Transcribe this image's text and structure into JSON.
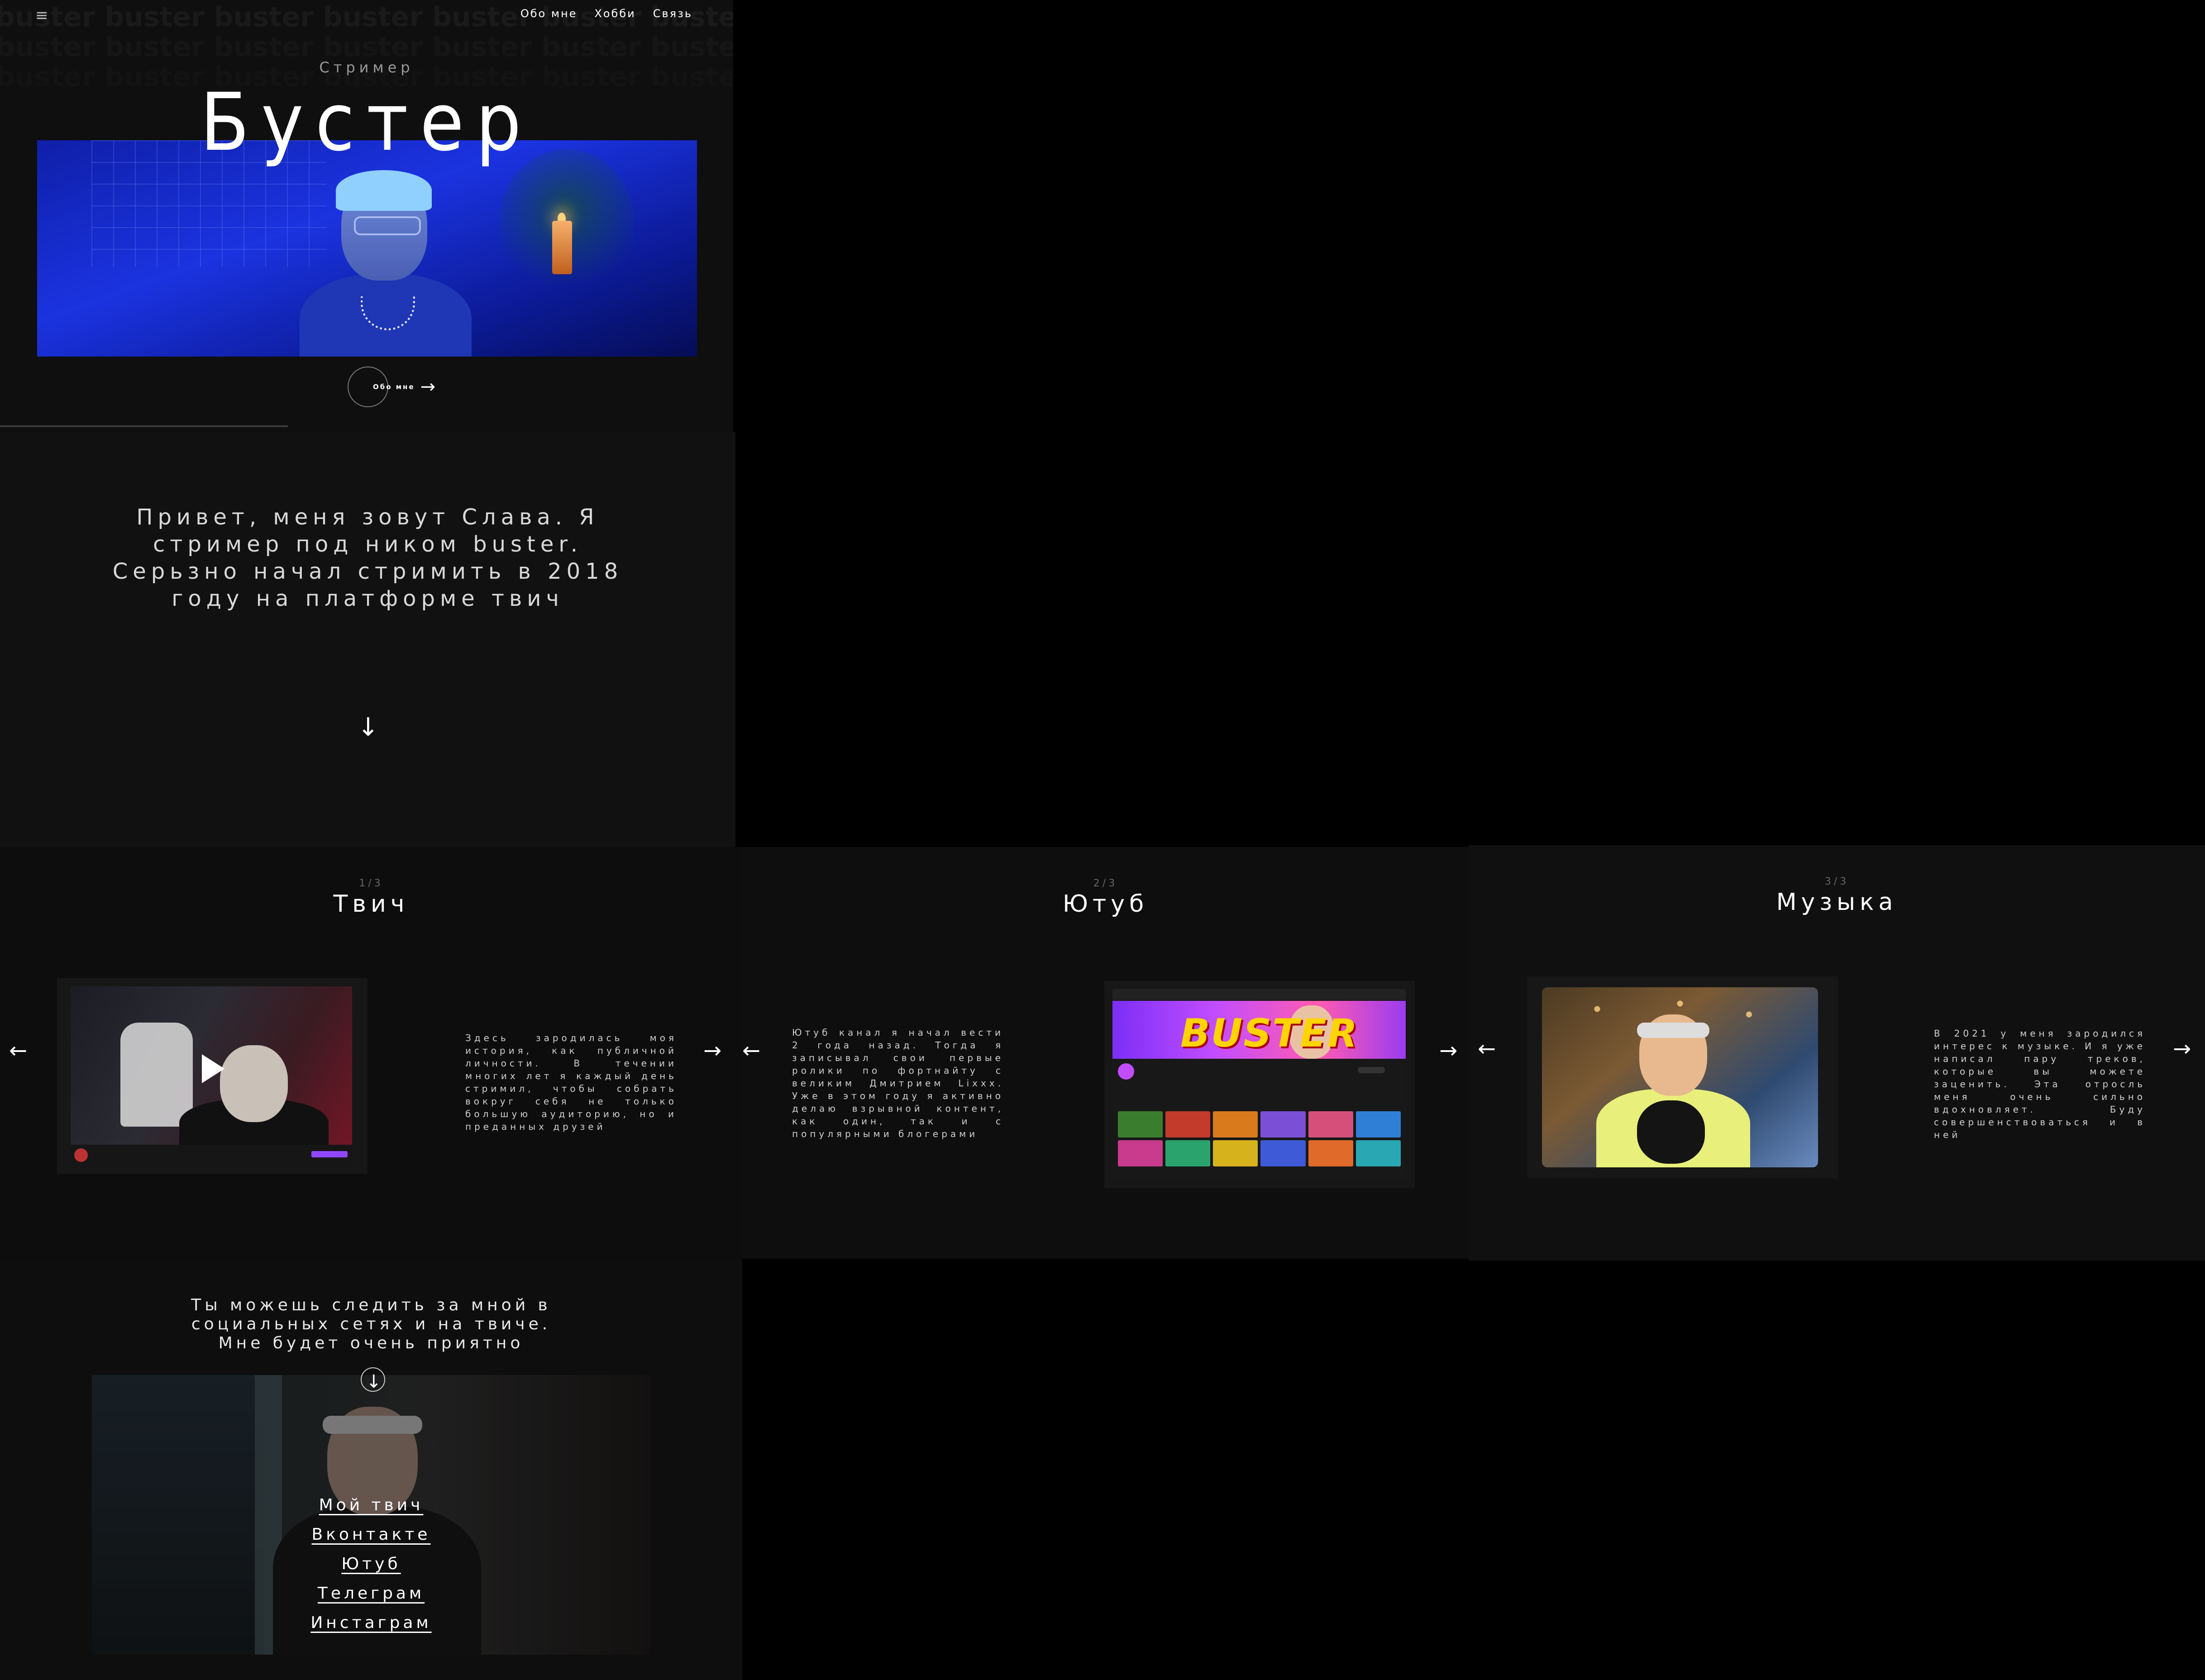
{
  "header": {
    "bg_word": "buster",
    "nav": [
      "Обо мне",
      "Хобби",
      "Связь"
    ]
  },
  "hero": {
    "subtitle": "Стример",
    "title": "Бустер",
    "about_button": "Обо мне",
    "arrow": "→"
  },
  "intro": {
    "text": "Привет, меня зовут Слава. Я стример под ником buster. Серьзно начал стримить в 2018 году на платформе твич",
    "arrow": "↓"
  },
  "slides": [
    {
      "counter": "1/3",
      "title": "Твич",
      "description": "Здесь зародилась моя история, как публичной личности. В течении многих лет я каждый день стримил, чтобы собрать вокруг себя не только большую аудиторию, но и преданных друзей"
    },
    {
      "counter": "2/3",
      "title": "Ютуб",
      "description": "Ютуб канал я начал вести 2 года назад. Тогда я записывал свои первые ролики по фортнайту с великим Дмитрием Lixxx. Уже в этом году я активно делаю взрывной контент, как один, так и с популярными блогерами",
      "banner_logo": "BUSTER"
    },
    {
      "counter": "3/3",
      "title": "Музыка",
      "description": "В 2021 у меня зародился интерес к музыке. И я уже написал пару треков, которые вы можете заценить. Эта отросль меня очень сильно вдохновляет. Буду совершенствоваться и в ней"
    }
  ],
  "slider_nav": {
    "prev": "←",
    "next": "→"
  },
  "follow": {
    "text": "Ты можешь следить за мной в социальных сетях и на твиче. Мне будет очень приятно",
    "arrow": "↓",
    "links": [
      "Мой твич",
      "Вконтакте",
      "Ютуб",
      "Телеграм",
      "Инстаграм"
    ]
  },
  "icons": {
    "menu": "menu-icon",
    "play": "play-icon"
  },
  "colors": {
    "background": "#000000",
    "section": "#0f0f0f",
    "hero_photo": "#1b33e0",
    "twitch_accent": "#9147ff",
    "yt_banner_logo": "#ffd400"
  }
}
